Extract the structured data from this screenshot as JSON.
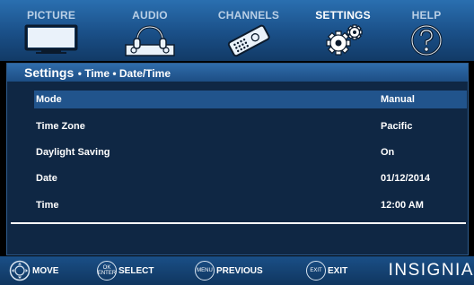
{
  "tabs": [
    {
      "label": "PICTURE",
      "icon": "tv-icon",
      "active": false
    },
    {
      "label": "AUDIO",
      "icon": "headphones-icon",
      "active": false
    },
    {
      "label": "CHANNELS",
      "icon": "remote-control-icon",
      "active": false
    },
    {
      "label": "SETTINGS",
      "icon": "gears-icon",
      "active": true
    },
    {
      "label": "HELP",
      "icon": "help-icon",
      "active": false
    }
  ],
  "panel": {
    "title": "Settings",
    "breadcrumb": "• Time • Date/Time",
    "rows": [
      {
        "label": "Mode",
        "value": "Manual",
        "selected": true
      },
      {
        "label": "Time Zone",
        "value": "Pacific",
        "selected": false
      },
      {
        "label": "Daylight Saving",
        "value": "On",
        "selected": false
      },
      {
        "label": "Date",
        "value": "01/12/2014",
        "selected": false
      },
      {
        "label": "Time",
        "value": "12:00 AM",
        "selected": false
      }
    ]
  },
  "hints": {
    "move": {
      "label": "MOVE",
      "button": ""
    },
    "select": {
      "label": "SELECT",
      "button": "OK\nENTER"
    },
    "previous": {
      "label": "PREVIOUS",
      "button": "MENU"
    },
    "exit": {
      "label": "EXIT",
      "button": "EXIT"
    }
  },
  "brand": "INSIGNIA",
  "colors": {
    "accent": "#1d4e84",
    "selected_row": "#21548c",
    "panel_bg": "#0f2744"
  }
}
